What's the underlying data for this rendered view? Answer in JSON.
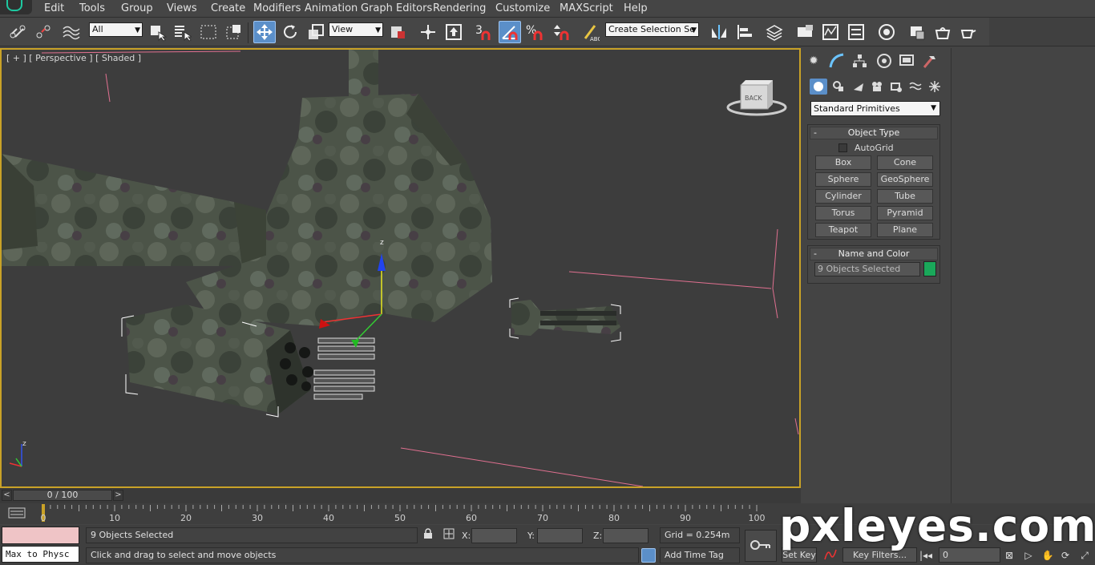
{
  "menu": {
    "items": [
      "Edit",
      "Tools",
      "Group",
      "Views",
      "Create",
      "Modifiers",
      "Animation",
      "Graph Editors",
      "Rendering",
      "Customize",
      "MAXScript",
      "Help"
    ]
  },
  "toolbar": {
    "filter_value": "All",
    "coord_system": "View",
    "selection_set_placeholder": "Create Selection Se",
    "snap_label": "3",
    "icons": [
      "link-icon",
      "unlink-icon",
      "bind-space-warp-icon",
      "select-object-icon",
      "select-by-name-icon",
      "rect-region-icon",
      "window-crossing-icon",
      "move-icon",
      "rotate-icon",
      "scale-icon",
      "pivot-icon",
      "select-manipulate-icon",
      "snap-toggle-icon",
      "angle-snap-icon",
      "percent-snap-icon",
      "spinner-snap-icon",
      "edit-named-sets-icon",
      "mirror-icon",
      "align-icon",
      "layer-manager-icon",
      "material-editor-icon",
      "render-setup-icon",
      "rendered-frame-icon",
      "render-icon"
    ]
  },
  "viewport": {
    "label": "[ + ] [ Perspective ] [ Shaded ]",
    "viewcube_label": "BACK",
    "gizmo_axis": "z",
    "small_axis_label": "z"
  },
  "command_panel": {
    "tabs": [
      "create-tab-icon",
      "modify-tab-icon",
      "hierarchy-tab-icon",
      "motion-tab-icon",
      "display-tab-icon",
      "utilities-tab-icon"
    ],
    "subtabs": [
      "geometry-icon",
      "shapes-icon",
      "lights-icon",
      "cameras-icon",
      "helpers-icon",
      "space-warps-icon",
      "systems-icon"
    ],
    "category": "Standard Primitives",
    "object_type": {
      "title": "Object Type",
      "minus": "-",
      "autogrid": "AutoGrid",
      "buttons": [
        "Box",
        "Cone",
        "Sphere",
        "GeoSphere",
        "Cylinder",
        "Tube",
        "Torus",
        "Pyramid",
        "Teapot",
        "Plane"
      ]
    },
    "name_color": {
      "title": "Name and Color",
      "minus": "-",
      "name_value": "9 Objects Selected",
      "color": "#1aa85a"
    }
  },
  "timeline": {
    "slider_label": "0 / 100",
    "prev": "<",
    "next": ">",
    "ticks": [
      "0",
      "10",
      "20",
      "30",
      "40",
      "50",
      "60",
      "70",
      "80",
      "90",
      "100"
    ]
  },
  "status": {
    "listener_text": "Max to Physc",
    "selection": "9 Objects Selected",
    "prompt": "Click and drag to select and move objects",
    "x_label": "X:",
    "y_label": "Y:",
    "z_label": "Z:",
    "grid": "Grid = 0.254m",
    "add_time_tag": "Add Time Tag",
    "set_key": "Set Key",
    "key_filters": "Key Filters...",
    "frame_value": "0"
  },
  "watermark": "pxleyes.com"
}
